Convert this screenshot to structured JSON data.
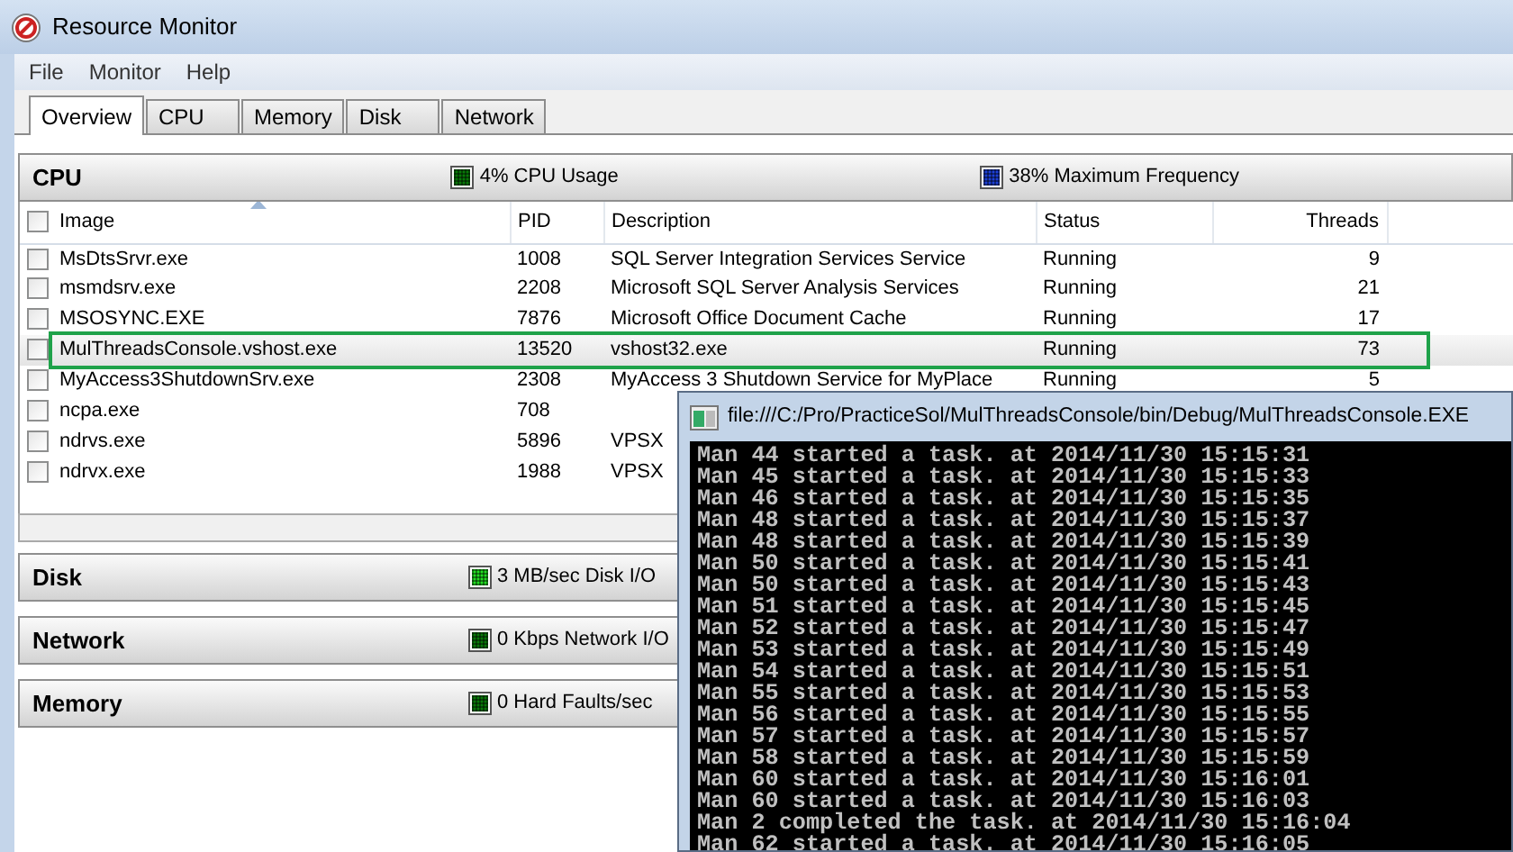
{
  "window": {
    "title": "Resource Monitor"
  },
  "menu": [
    "File",
    "Monitor",
    "Help"
  ],
  "tabs": [
    {
      "label": "Overview",
      "selected": true
    },
    {
      "label": "CPU",
      "selected": false
    },
    {
      "label": "Memory",
      "selected": false
    },
    {
      "label": "Disk",
      "selected": false
    },
    {
      "label": "Network",
      "selected": false
    }
  ],
  "panels": [
    {
      "title": "CPU",
      "expanded": true,
      "stats": [
        {
          "text": "4% CPU Usage",
          "color": "#087a08"
        },
        {
          "text": "38% Maximum Frequency",
          "color": "#1c3fd8"
        }
      ],
      "table": {
        "all_checked": false,
        "columns": [
          {
            "label": "Image",
            "sorted": true
          },
          {
            "label": "PID",
            "sorted": false
          },
          {
            "label": "Description",
            "sorted": false
          },
          {
            "label": "Status",
            "sorted": false
          },
          {
            "label": "Threads",
            "sorted": false
          }
        ],
        "rows": [
          {
            "checked": false,
            "highlighted": false,
            "cells": [
              "MsDtsSrvr.exe",
              "1008",
              "SQL Server Integration Services Service",
              "Running",
              "9"
            ]
          },
          {
            "checked": false,
            "highlighted": false,
            "cells": [
              "msmdsrv.exe",
              "2208",
              "Microsoft SQL Server Analysis Services",
              "Running",
              "21"
            ]
          },
          {
            "checked": false,
            "highlighted": false,
            "cells": [
              "MSOSYNC.EXE",
              "7876",
              "Microsoft Office Document Cache",
              "Running",
              "17"
            ]
          },
          {
            "checked": false,
            "highlighted": true,
            "cells": [
              "MulThreadsConsole.vshost.exe",
              "13520",
              "vshost32.exe",
              "Running",
              "73"
            ]
          },
          {
            "checked": false,
            "highlighted": false,
            "cells": [
              "MyAccess3ShutdownSrv.exe",
              "2308",
              "MyAccess 3 Shutdown Service for MyPlace",
              "Running",
              "5"
            ]
          },
          {
            "checked": false,
            "highlighted": false,
            "cells": [
              "ncpa.exe",
              "708"
            ]
          },
          {
            "checked": false,
            "highlighted": false,
            "cells": [
              "ndrvs.exe",
              "5896",
              "VPSX"
            ]
          },
          {
            "checked": false,
            "highlighted": false,
            "cells": [
              "ndrvx.exe",
              "1988",
              "VPSX"
            ]
          }
        ]
      }
    },
    {
      "title": "Disk",
      "expanded": false,
      "stats": [
        {
          "text": "3 MB/sec Disk I/O",
          "color": "#22e022"
        }
      ]
    },
    {
      "title": "Network",
      "expanded": false,
      "stats": [
        {
          "text": "0 Kbps Network I/O",
          "color": "#087a08"
        }
      ]
    },
    {
      "title": "Memory",
      "expanded": false,
      "stats": [
        {
          "text": "0 Hard Faults/sec",
          "color": "#087a08"
        }
      ]
    }
  ],
  "console": {
    "title": "file:///C:/Pro/PracticeSol/MulThreadsConsole/bin/Debug/MulThreadsConsole.EXE",
    "lines": [
      "Man 44 started a task. at 2014/11/30 15:15:31",
      "Man 45 started a task. at 2014/11/30 15:15:33",
      "Man 46 started a task. at 2014/11/30 15:15:35",
      "Man 48 started a task. at 2014/11/30 15:15:37",
      "Man 48 started a task. at 2014/11/30 15:15:39",
      "Man 50 started a task. at 2014/11/30 15:15:41",
      "Man 50 started a task. at 2014/11/30 15:15:43",
      "Man 51 started a task. at 2014/11/30 15:15:45",
      "Man 52 started a task. at 2014/11/30 15:15:47",
      "Man 53 started a task. at 2014/11/30 15:15:49",
      "Man 54 started a task. at 2014/11/30 15:15:51",
      "Man 55 started a task. at 2014/11/30 15:15:53",
      "Man 56 started a task. at 2014/11/30 15:15:55",
      "Man 57 started a task. at 2014/11/30 15:15:57",
      "Man 58 started a task. at 2014/11/30 15:15:59",
      "Man 60 started a task. at 2014/11/30 15:16:01",
      "Man 60 started a task. at 2014/11/30 15:16:03",
      "Man 2 completed the task. at 2014/11/30 15:16:04",
      "Man 62 started a task. at 2014/11/30 15:16:05"
    ]
  }
}
